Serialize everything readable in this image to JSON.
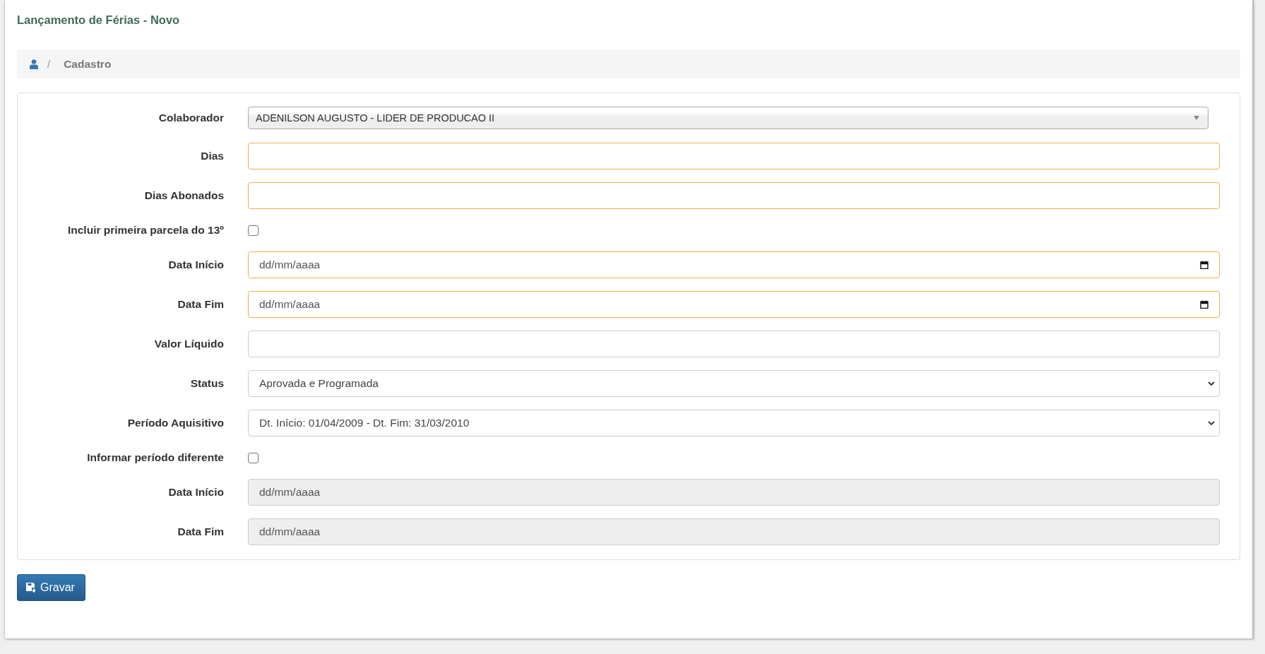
{
  "page_title": "Lançamento de Férias - Novo",
  "breadcrumb": {
    "separator": "/",
    "items": [
      {
        "label": "Cadastro"
      }
    ]
  },
  "form": {
    "fields": [
      {
        "kind": "combo",
        "label": "Colaborador",
        "value": "ADENILSON AUGUSTO - LIDER DE PRODUCAO II"
      },
      {
        "kind": "text",
        "label": "Dias",
        "required": true,
        "disabled": false
      },
      {
        "kind": "text",
        "label": "Dias Abonados",
        "required": true,
        "disabled": false
      },
      {
        "kind": "checkbox",
        "label": "Incluir primeira parcela do 13º",
        "checked": false
      },
      {
        "kind": "date",
        "label": "Data Início",
        "placeholder": "dd/mm/aaaa",
        "required": true,
        "disabled": false
      },
      {
        "kind": "date",
        "label": "Data Fim",
        "placeholder": "dd/mm/aaaa",
        "required": true,
        "disabled": false
      },
      {
        "kind": "text",
        "label": "Valor Líquido",
        "required": false,
        "disabled": false
      },
      {
        "kind": "select",
        "label": "Status",
        "value": "Aprovada e Programada"
      },
      {
        "kind": "select",
        "label": "Período Aquisitivo",
        "value": "Dt. Início: 01/04/2009 - Dt. Fim: 31/03/2010"
      },
      {
        "kind": "checkbox",
        "label": "Informar período diferente",
        "checked": false
      },
      {
        "kind": "date",
        "label": "Data Início",
        "placeholder": "dd/mm/aaaa",
        "required": false,
        "disabled": true
      },
      {
        "kind": "date",
        "label": "Data Fim",
        "placeholder": "dd/mm/aaaa",
        "required": false,
        "disabled": true
      }
    ]
  },
  "save_button": {
    "label": "Gravar"
  }
}
